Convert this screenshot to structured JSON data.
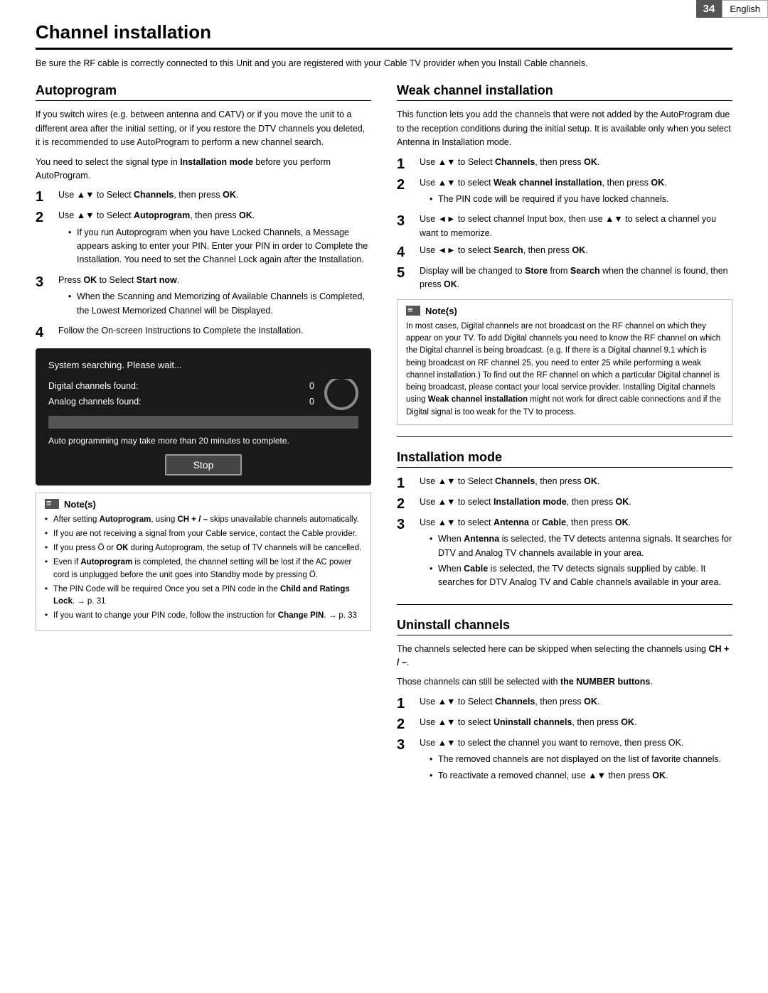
{
  "header": {
    "page_number": "34",
    "language": "English"
  },
  "page_title": "Channel installation",
  "page_intro": "Be sure the RF cable is correctly connected to this Unit and you are registered with your Cable TV provider when you Install Cable channels.",
  "left_col": {
    "autoprogram": {
      "title": "Autoprogram",
      "intro": "If you switch wires (e.g. between antenna and CATV) or if you move the unit to a different area after the initial setting, or if you restore the DTV channels you deleted, it is recommended to use AutoProgram to perform a new channel search.",
      "note_before": "You need to select the signal type in Installation mode before you perform AutoProgram.",
      "steps": [
        {
          "num": "1",
          "text": "Use ▲▼ to Select Channels, then press OK."
        },
        {
          "num": "2",
          "text": "Use ▲▼ to Select Autoprogram, then press OK."
        }
      ],
      "sub_bullet": "If you run Autoprogram when you have Locked Channels, a Message appears asking to enter your PIN. Enter your PIN in order to Complete the Installation. You need to set the Channel Lock again after the Installation.",
      "step3": "Press OK to Select Start now.",
      "step3_bullet": "When the Scanning and Memorizing of Available Channels is Completed, the Lowest Memorized Channel will be Displayed.",
      "step4": "Follow the On-screen Instructions to Complete the Installation.",
      "screen": {
        "title": "System searching. Please wait...",
        "digital_label": "Digital channels found:",
        "digital_value": "0",
        "analog_label": "Analog channels found:",
        "analog_value": "0",
        "sub_text": "Auto programming may take more than 20 minutes to complete.",
        "stop_label": "Stop"
      },
      "notes_header": "Note(s)",
      "notes": [
        "After setting Autoprogram, using CH + / – skips unavailable channels automatically.",
        "If you are not receiving a signal from your Cable service, contact the Cable provider.",
        "If you press Ö or OK during Autoprogram, the setup of TV channels will be cancelled.",
        "Even if Autoprogram is completed, the channel setting will be lost if the AC power cord is unplugged before the unit goes into Standby mode by pressing Ö.",
        "The PIN Code will be required Once you set a PIN code in the Child and Ratings Lock. → p. 31",
        "If you want to change your PIN code, follow the instruction for Change PIN. → p. 33"
      ]
    }
  },
  "right_col": {
    "weak_channel": {
      "title": "Weak channel installation",
      "intro": "This function lets you add the channels that were not added by the AutoProgram due to the reception conditions during the initial setup. It is available only when you select Antenna in Installation mode.",
      "steps": [
        {
          "num": "1",
          "text": "Use ▲▼ to Select Channels, then press OK."
        },
        {
          "num": "2",
          "text": "Use ▲▼ to select Weak channel installation, then press OK."
        }
      ],
      "bullet1": "The PIN code will be required if you have locked channels.",
      "step3": "Use ◄► to select channel Input box, then use ▲▼ to select a channel you want to memorize.",
      "step4": "Use ◄► to select Search, then press OK.",
      "step5": "Display will be changed to Store from Search when the channel is found, then press OK.",
      "notes_header": "Note(s)",
      "notes_text": "In most cases, Digital channels are not broadcast on the RF channel on which they appear on your TV. To add Digital channels you need to know the RF channel on which the Digital channel is being broadcast. (e.g. If there is a Digital channel 9.1 which is being broadcast on RF channel 25, you need to enter 25 while performing a weak channel installation.) To find out the RF channel on which a particular Digital channel is being broadcast, please contact your local service provider. Installing Digital channels using Weak channel installation might not work for direct cable connections and if the Digital signal is too weak for the TV to process."
    },
    "installation_mode": {
      "title": "Installation mode",
      "steps": [
        {
          "num": "1",
          "text": "Use ▲▼ to Select Channels, then press OK."
        },
        {
          "num": "2",
          "text": "Use ▲▼ to select Installation mode, then press OK."
        },
        {
          "num": "3",
          "text": "Use ▲▼ to select Antenna or Cable, then press OK."
        }
      ],
      "bullet1": "When Antenna is selected, the TV detects antenna signals. It searches for DTV and Analog TV channels available in your area.",
      "bullet2": "When Cable is selected, the TV detects signals supplied by cable. It searches for DTV Analog TV and Cable channels available in your area."
    },
    "uninstall_channels": {
      "title": "Uninstall channels",
      "intro1": "The channels selected here can be skipped when selecting the channels using CH + / –.",
      "intro2": "Those channels can still be selected with the NUMBER buttons.",
      "steps": [
        {
          "num": "1",
          "text": "Use ▲▼ to Select Channels, then press OK."
        },
        {
          "num": "2",
          "text": "Use ▲▼ to select Uninstall channels, then press OK."
        },
        {
          "num": "3",
          "text": "Use ▲▼ to select the channel you want to remove, then press OK."
        }
      ],
      "bullet1": "The removed channels are not displayed on the list of favorite channels.",
      "bullet2": "To reactivate a removed channel, use ▲▼ then press OK."
    }
  }
}
